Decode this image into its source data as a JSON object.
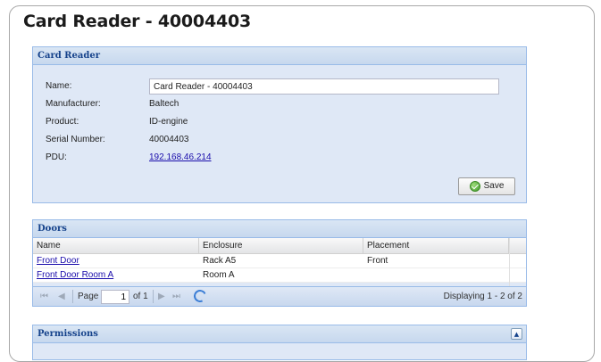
{
  "page": {
    "title": "Card Reader - 40004403"
  },
  "card_reader": {
    "header": "Card Reader",
    "name_label": "Name:",
    "name_value": "Card Reader - 40004403",
    "manufacturer_label": "Manufacturer:",
    "manufacturer_value": "Baltech",
    "product_label": "Product:",
    "product_value": "ID-engine",
    "serial_label": "Serial Number:",
    "serial_value": "40004403",
    "pdu_label": "PDU:",
    "pdu_value": "192.168.46.214",
    "save_label": "Save"
  },
  "doors": {
    "header": "Doors",
    "columns": [
      "Name",
      "Enclosure",
      "Placement"
    ],
    "rows": [
      {
        "name": "Front Door",
        "enclosure": "Rack A5",
        "placement": "Front"
      },
      {
        "name": "Front Door Room A",
        "enclosure": "Room A",
        "placement": ""
      }
    ],
    "pager": {
      "first": "⏮",
      "prev": "◀",
      "page_label": "Page",
      "page_value": "1",
      "of_label": "of 1",
      "next": "▶",
      "last": "⏭",
      "displaying": "Displaying 1 - 2 of 2"
    }
  },
  "permissions": {
    "header": "Permissions",
    "collapse": "▲"
  }
}
